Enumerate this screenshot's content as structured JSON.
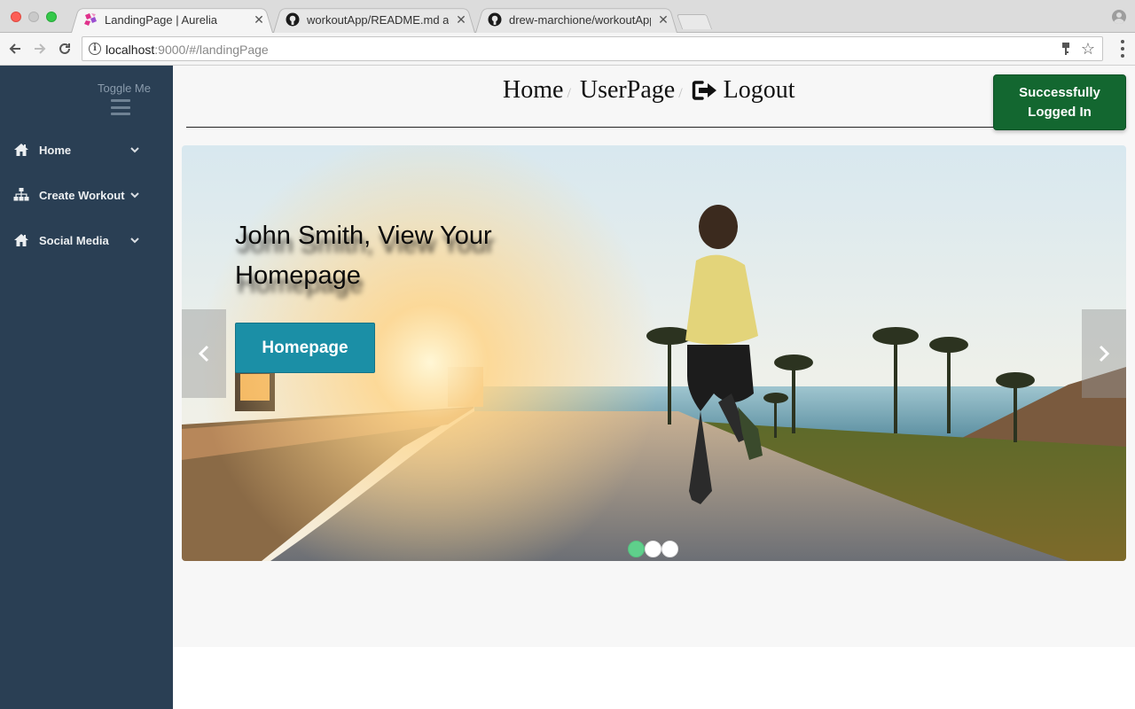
{
  "browser": {
    "tabs": [
      {
        "title": "LandingPage | Aurelia",
        "active": true,
        "favicon": "aurelia-icon"
      },
      {
        "title": "workoutApp/README.md at m",
        "active": false,
        "favicon": "github-icon"
      },
      {
        "title": "drew-marchione/workoutApp",
        "active": false,
        "favicon": "github-icon"
      }
    ],
    "url_host": "localhost",
    "url_rest": ":9000/#/landingPage"
  },
  "sidebar": {
    "toggle_label": "Toggle Me",
    "items": [
      {
        "label": "Home",
        "icon": "home-icon"
      },
      {
        "label": "Create Workout",
        "icon": "sitemap-icon"
      },
      {
        "label": "Social Media",
        "icon": "home-icon"
      }
    ]
  },
  "topnav": {
    "home": "Home",
    "userpage": "UserPage",
    "logout": "Logout",
    "separator": "/"
  },
  "toast": {
    "line1": "Successfully",
    "line2": "Logged In",
    "color": "#136730"
  },
  "carousel": {
    "title_line1": "John Smith, View Your",
    "title_line2": "Homepage",
    "button": "Homepage",
    "slides": 3,
    "active_slide": 1,
    "accent": "#1b8fa6"
  }
}
